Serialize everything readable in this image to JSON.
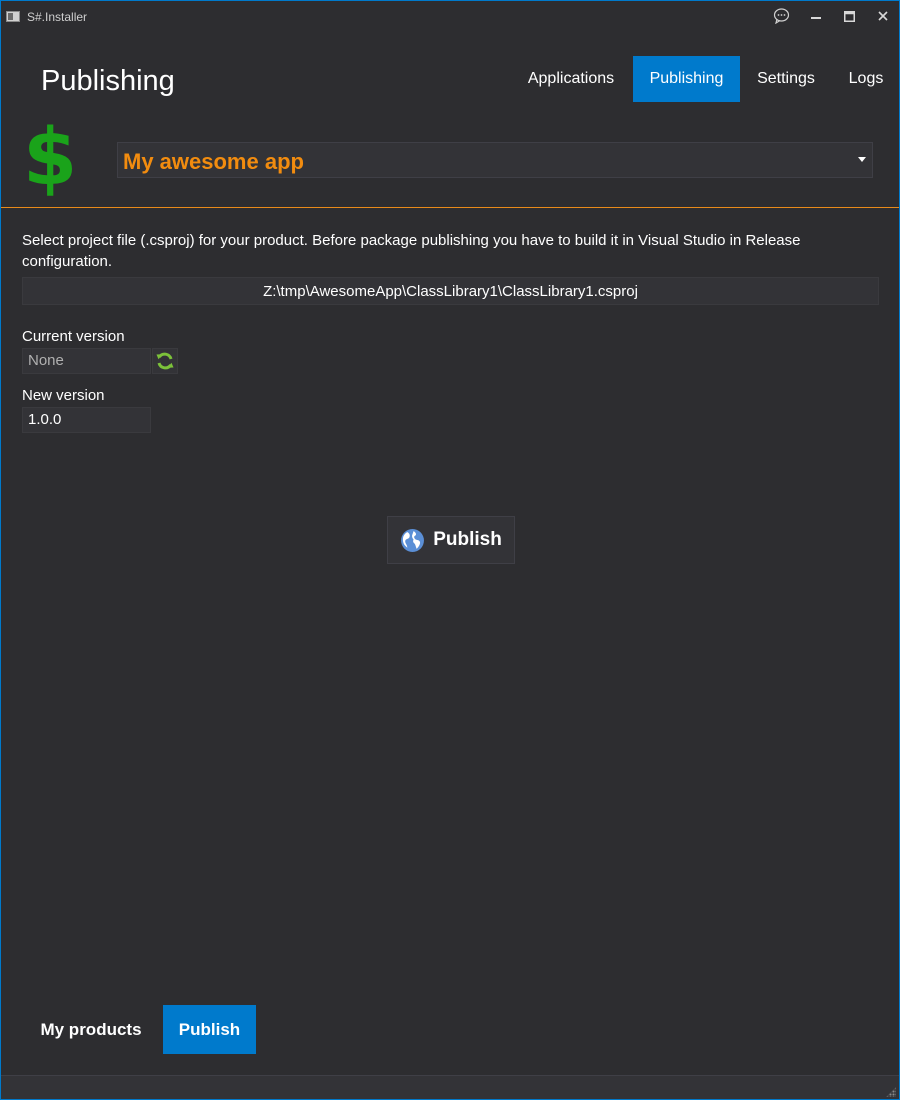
{
  "window": {
    "title": "S#.Installer"
  },
  "titlebar": {
    "feedback_icon": "chat-bubble-icon",
    "minimize_icon": "minimize-icon",
    "maximize_icon": "maximize-icon",
    "close_icon": "close-icon"
  },
  "header": {
    "title": "Publishing",
    "nav": [
      {
        "label": "Applications",
        "active": false
      },
      {
        "label": "Publishing",
        "active": true
      },
      {
        "label": "Settings",
        "active": false
      },
      {
        "label": "Logs",
        "active": false
      }
    ]
  },
  "product": {
    "logo": "$",
    "selected": "My awesome app"
  },
  "form": {
    "description": "Select project file (.csproj) for your product. Before package publishing you have to build it in Visual Studio in Release configuration.",
    "project_path": "Z:\\tmp\\AwesomeApp\\ClassLibrary1\\ClassLibrary1.csproj",
    "current_version_label": "Current version",
    "current_version_value": "None",
    "new_version_label": "New version",
    "new_version_value": "1.0.0",
    "publish_label": "Publish"
  },
  "bottom_tabs": [
    {
      "label": "My products",
      "active": false
    },
    {
      "label": "Publish",
      "active": true
    }
  ],
  "colors": {
    "accent": "#007acc",
    "product_name": "#f28c0f",
    "divider": "#e88a1a",
    "logo": "#1aa31a",
    "refresh": "#7cc23a",
    "globe": "#5b8fd6"
  }
}
